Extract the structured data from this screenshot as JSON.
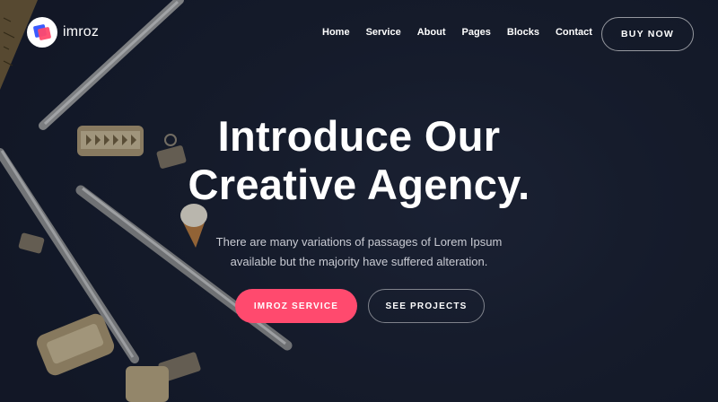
{
  "header": {
    "logo_text": "imroz",
    "nav": [
      "Home",
      "Service",
      "About",
      "Pages",
      "Blocks",
      "Contact"
    ],
    "cta_label": "BUY NOW"
  },
  "hero": {
    "headline_line1": "Introduce Our",
    "headline_line2": "Creative Agency.",
    "subtitle_line1": "There are many variations of passages of Lorem Ipsum",
    "subtitle_line2": "available but the majority have suffered alteration.",
    "primary_button": "IMROZ SERVICE",
    "secondary_button": "SEE PROJECTS"
  },
  "colors": {
    "background": "#141a29",
    "accent": "#ff4a6e",
    "logo_blue": "#3b5bff"
  }
}
